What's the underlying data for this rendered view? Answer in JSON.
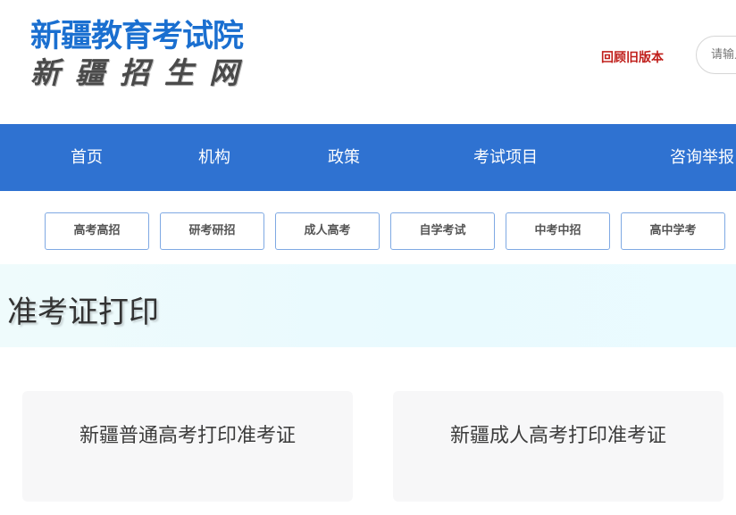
{
  "header": {
    "logo_main": "新疆教育考试院",
    "logo_sub": "新疆招生网",
    "old_version_link": "回顾旧版本",
    "search_placeholder": "请输入关键字"
  },
  "nav": {
    "items": [
      {
        "label": "首页"
      },
      {
        "label": "机构"
      },
      {
        "label": "政策"
      },
      {
        "label": "考试项目"
      },
      {
        "label": "咨询举报"
      }
    ]
  },
  "subnav": {
    "items": [
      {
        "label": "高考高招"
      },
      {
        "label": "研考研招"
      },
      {
        "label": "成人高考"
      },
      {
        "label": "自学考试"
      },
      {
        "label": "中考中招"
      },
      {
        "label": "高中学考"
      }
    ]
  },
  "banner": {
    "title": "准考证打印"
  },
  "cards": [
    {
      "label": "新疆普通高考打印准考证"
    },
    {
      "label": "新疆成人高考打印准考证"
    }
  ],
  "colors": {
    "brand_blue": "#2f72d1",
    "logo_blue": "#1a6fd0",
    "link_red": "#c0201c"
  }
}
